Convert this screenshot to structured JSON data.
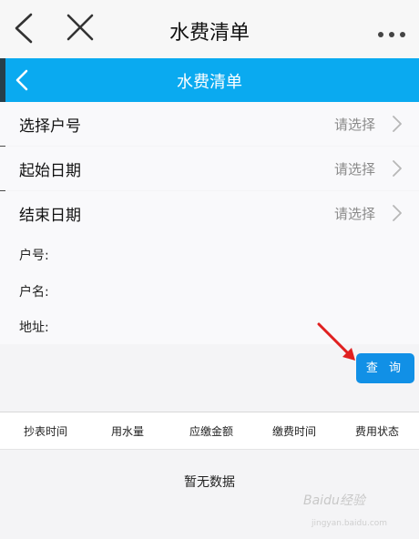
{
  "window": {
    "title": "水费清单"
  },
  "header": {
    "title": "水费清单"
  },
  "form": {
    "rows": [
      {
        "label": "选择户号",
        "value": "请选择"
      },
      {
        "label": "起始日期",
        "value": "请选择"
      },
      {
        "label": "结束日期",
        "value": "请选择"
      }
    ],
    "info": {
      "account_label": "户号:",
      "name_label": "户名:",
      "address_label": "地址:"
    },
    "query_button": "查 询"
  },
  "table": {
    "columns": [
      "抄表时间",
      "用水量",
      "应缴金额",
      "缴费时间",
      "费用状态"
    ],
    "empty_text": "暂无数据"
  },
  "watermark": {
    "text": "Baidu经验",
    "sub": "jingyan.baidu.com"
  },
  "colors": {
    "accent": "#0aaaf0",
    "button": "#1190e6",
    "arrow": "#e02020"
  },
  "icons": [
    "back-chevron-icon",
    "close-icon",
    "more-dots-icon",
    "chevron-right-icon",
    "arrow-indicator"
  ]
}
